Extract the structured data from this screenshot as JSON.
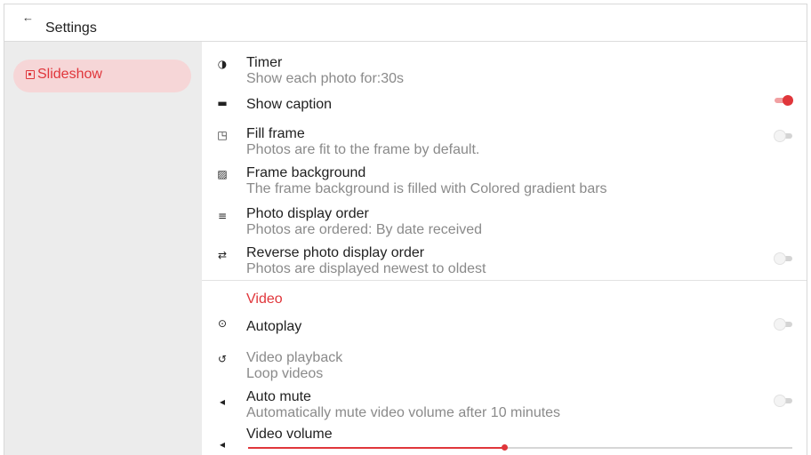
{
  "header": {
    "back_icon": "arrow-back-icon",
    "back_glyph": "←",
    "title": "Settings"
  },
  "sidebar": {
    "items": [
      {
        "label": "Slideshow",
        "icon": "slideshow-icon",
        "selected": true
      }
    ]
  },
  "slideshow": {
    "timer": {
      "icon": "timer-icon",
      "glyph": "◑",
      "title": "Timer",
      "subtitle": "Show each photo for:30s"
    },
    "show_caption": {
      "icon": "caption-icon",
      "glyph": "▬",
      "title": "Show caption",
      "enabled": true
    },
    "fill_frame": {
      "icon": "fill-frame-icon",
      "glyph": "◳",
      "title": "Fill frame",
      "subtitle": "Photos are fit to the frame by default.",
      "enabled": false
    },
    "frame_background": {
      "icon": "frame-background-icon",
      "glyph": "▨",
      "title": "Frame background",
      "subtitle": "The frame background is filled with Colored gradient bars"
    },
    "photo_display_order": {
      "icon": "sort-icon",
      "glyph": "≡",
      "title": "Photo display order",
      "subtitle": "Photos are ordered: By date received"
    },
    "reverse_order": {
      "icon": "swap-icon",
      "glyph": "⇄",
      "title": "Reverse photo display order",
      "subtitle": "Photos are displayed newest to oldest",
      "enabled": false
    }
  },
  "video": {
    "section_title": "Video",
    "autoplay": {
      "icon": "play-circle-icon",
      "glyph": "⊙",
      "title": "Autoplay",
      "enabled": false
    },
    "playback": {
      "icon": "replay-icon",
      "glyph": "↺",
      "title": "Video playback",
      "subtitle": "Loop videos"
    },
    "auto_mute": {
      "icon": "mute-icon",
      "glyph": "◂",
      "title": "Auto mute",
      "subtitle": "Automatically mute video volume after 10 minutes",
      "enabled": false
    },
    "volume": {
      "icon": "volume-icon",
      "glyph": "◂",
      "title": "Video volume",
      "level": 0.47
    }
  },
  "colors": {
    "accent": "#e0363b",
    "sidebar_bg": "#ececec",
    "selected_pill": "#f6d6d7"
  }
}
